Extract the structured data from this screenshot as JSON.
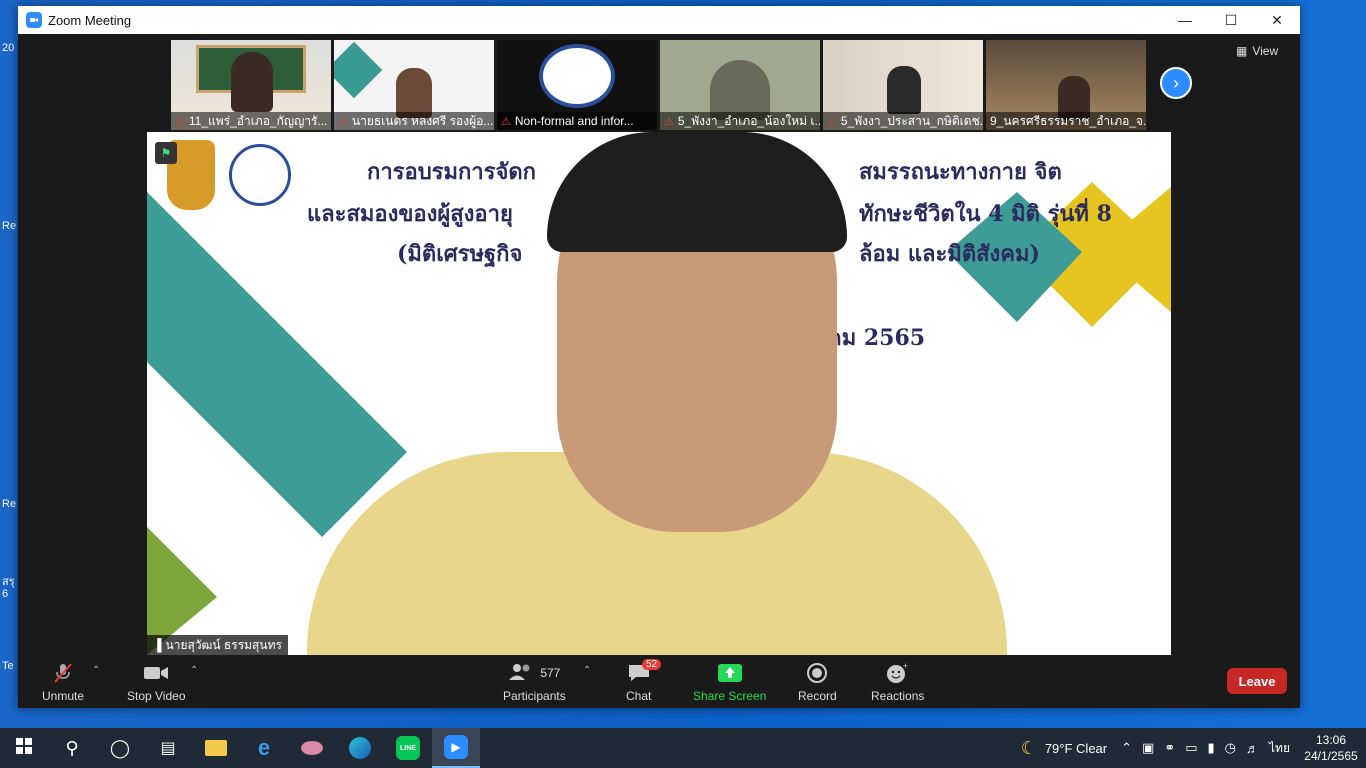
{
  "window": {
    "title": "Zoom Meeting"
  },
  "thumbnails": [
    {
      "name": "11_แพร่_อำเภอ_กัญญารั..."
    },
    {
      "name": "นายธเนตร หลงศรี รองผู้อ..."
    },
    {
      "name": "Non-formal and infor..."
    },
    {
      "name": "5_พังงา_อำเภอ_น้องใหม่ เ..."
    },
    {
      "name": "5_พังงา_ประสาน_กษิติเดช..."
    },
    {
      "name": "9_นครศรีธรรมราช_อำเภอ_จ..."
    }
  ],
  "view_label": "View",
  "slide": {
    "line1a": "การอบรมการจัดก",
    "line1b": "สมรรถนะทางกาย  จิต",
    "line2a": "และสมองของผู้สูงอายุ",
    "line2b": "ทักษะชีวิตใน 4 มิติ  รุ่นที่ 8",
    "line3a": "(มิติเศรษฐกิจ",
    "line3b": "ล้อม  และมิติสังคม)",
    "line4": "คม 2565"
  },
  "speaker_name": "นายสุวัฒน์ ธรรมสุนทร",
  "toolbar": {
    "unmute": "Unmute",
    "stop_video": "Stop Video",
    "participants_count": "577",
    "participants": "Participants",
    "chat": "Chat",
    "chat_badge": "52",
    "share_screen": "Share Screen",
    "record": "Record",
    "reactions": "Reactions",
    "leave": "Leave"
  },
  "tray": {
    "weather": "79°F  Clear",
    "lang": "ไทย",
    "time": "13:06",
    "date": "24/1/2565"
  },
  "desktop_labels": [
    "20",
    "Re",
    "Re",
    "สรุ",
    "6",
    "Te"
  ],
  "colors": {
    "zoom_blue": "#2d8cff",
    "leave_red": "#c62828",
    "share_green": "#23d959"
  }
}
